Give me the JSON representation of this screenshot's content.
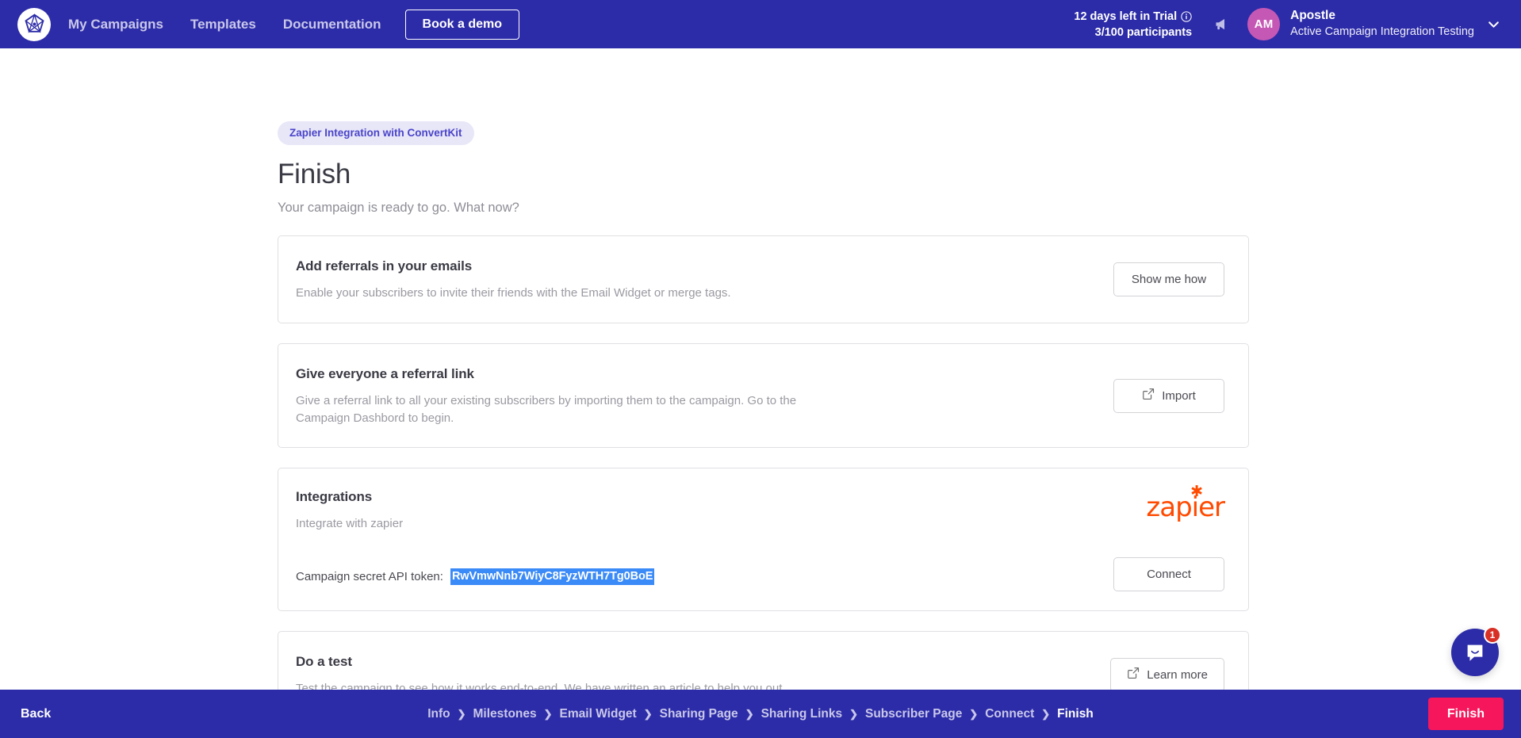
{
  "theme": {
    "nav_bg": "#2D2CA8",
    "accent": "#4A45C9",
    "finish_btn": "#F5165C",
    "zapier_orange": "#FF4A00",
    "selection_blue": "#3A8AF7",
    "avatar_bg": "#C658B5"
  },
  "topnav": {
    "logo_name": "apostle-logo",
    "links": [
      {
        "label": "My Campaigns"
      },
      {
        "label": "Templates"
      },
      {
        "label": "Documentation"
      }
    ],
    "demo_button": "Book a demo",
    "trial": {
      "line1": "12 days left in Trial",
      "line2": "3/100 participants"
    },
    "account": {
      "initials": "AM",
      "name": "Apostle",
      "subtitle": "Active Campaign Integration Testing"
    }
  },
  "main": {
    "badge": "Zapier Integration with ConvertKit",
    "title": "Finish",
    "subtitle": "Your campaign is ready to go. What now?",
    "cards": [
      {
        "title": "Add referrals in your emails",
        "description": "Enable your subscribers to invite their friends with the Email Widget or merge tags.",
        "button": "Show me how",
        "icon": ""
      },
      {
        "title": "Give everyone a referral link",
        "description": "Give a referral link to all your existing subscribers by importing them to the campaign. Go to the Campaign Dashbord to begin.",
        "button": "Import",
        "icon": "external-link-icon"
      },
      {
        "title": "Integrations",
        "description": "Integrate with zapier",
        "button": "Connect",
        "logo": "zapier",
        "logo_text": "zapier",
        "token_label": "Campaign secret API token:",
        "token_value": "RwVmwNnb7WiyC8FyzWTH7Tg0BoE"
      },
      {
        "title": "Do a test",
        "description": "Test the campaign to see how it works end-to-end. We have written an article to help you out.",
        "button": "Learn more",
        "icon": "external-link-icon"
      }
    ]
  },
  "bottombar": {
    "back": "Back",
    "finish": "Finish",
    "breadcrumbs": [
      {
        "label": "Info",
        "active": false
      },
      {
        "label": "Milestones",
        "active": false
      },
      {
        "label": "Email Widget",
        "active": false
      },
      {
        "label": "Sharing Page",
        "active": false
      },
      {
        "label": "Sharing Links",
        "active": false
      },
      {
        "label": "Subscriber Page",
        "active": false
      },
      {
        "label": "Connect",
        "active": false
      },
      {
        "label": "Finish",
        "active": true
      }
    ]
  },
  "intercom": {
    "badge_count": "1",
    "icon": "chat-smile-icon"
  }
}
